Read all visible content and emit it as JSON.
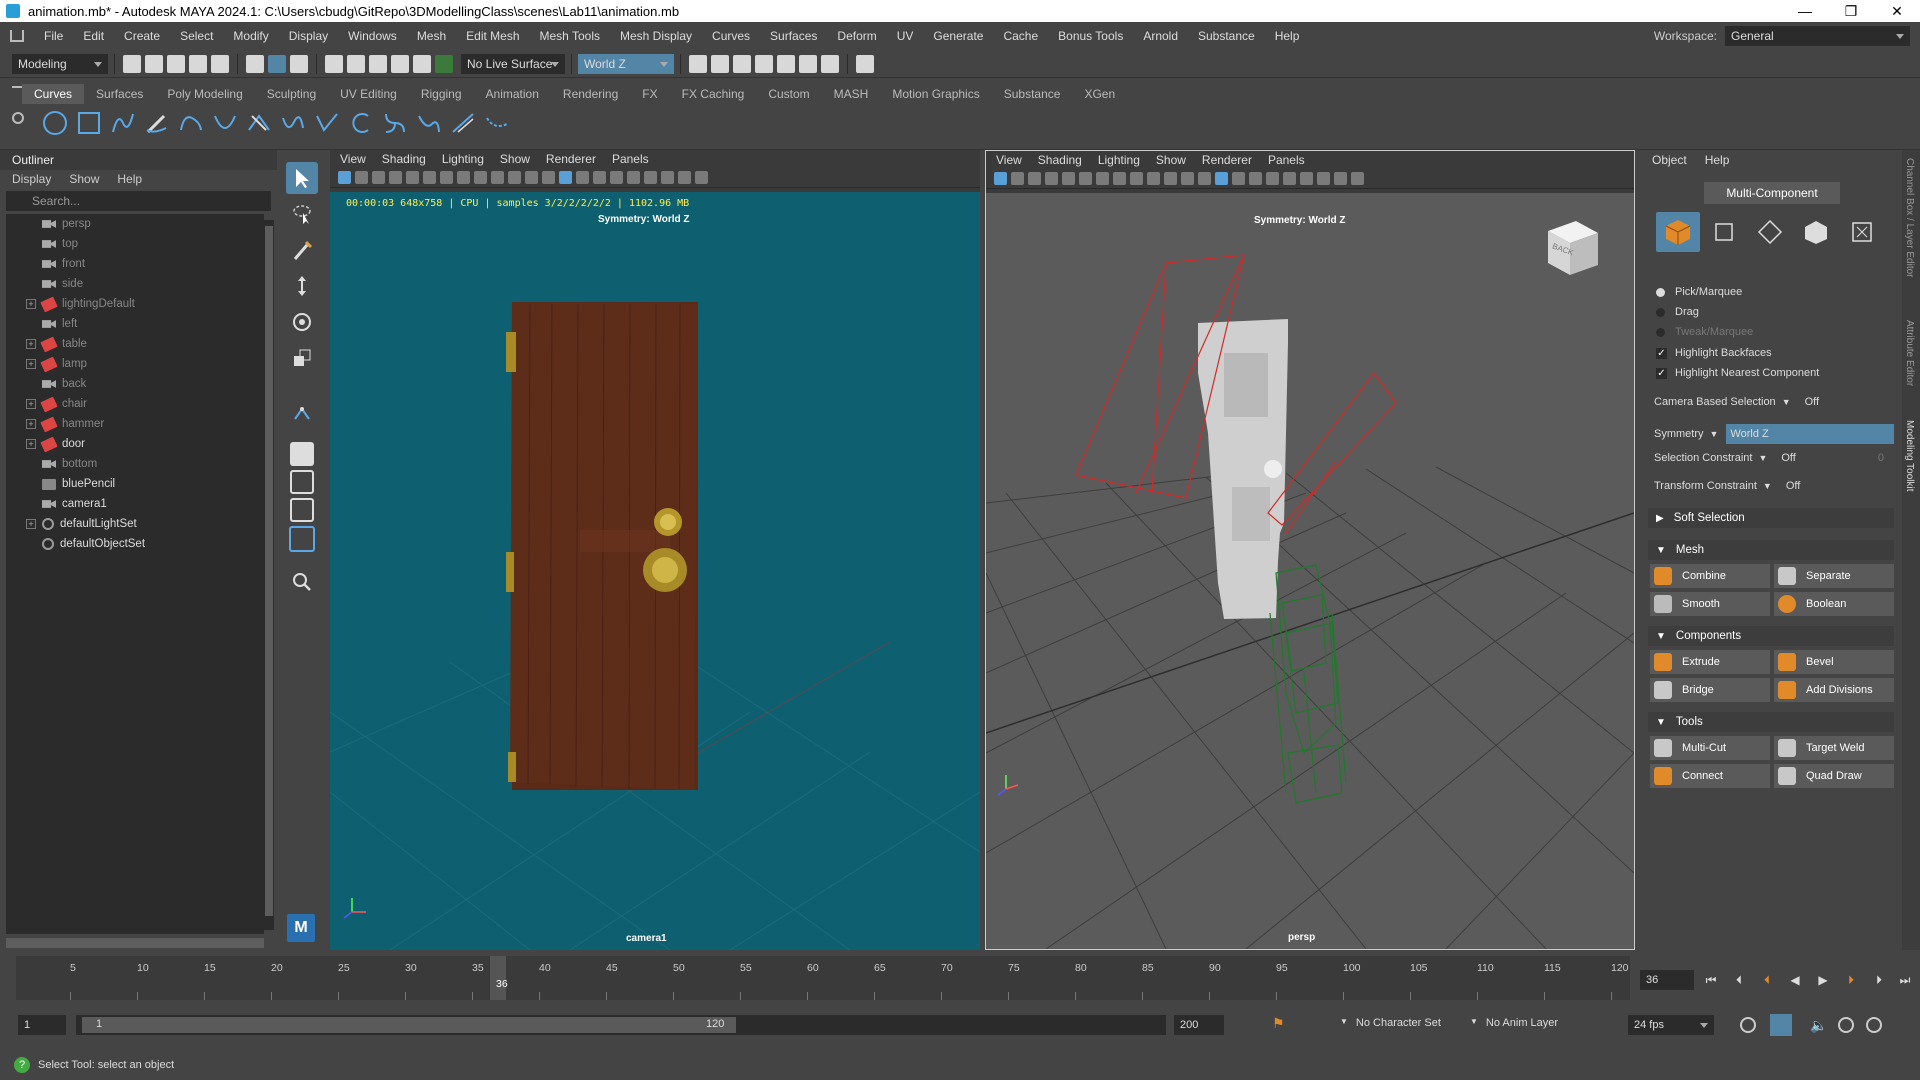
{
  "window": {
    "title": "animation.mb* - Autodesk MAYA 2024.1: C:\\Users\\cbudg\\GitRepo\\3DModellingClass\\scenes\\Lab11\\animation.mb",
    "controls": [
      "—",
      "❐",
      "✕"
    ]
  },
  "menubar": {
    "items": [
      "File",
      "Edit",
      "Create",
      "Select",
      "Modify",
      "Display",
      "Windows",
      "Mesh",
      "Edit Mesh",
      "Mesh Tools",
      "Mesh Display",
      "Curves",
      "Surfaces",
      "Deform",
      "UV",
      "Generate",
      "Cache",
      "Bonus Tools",
      "Arnold",
      "Substance",
      "Help"
    ],
    "workspace_label": "Workspace:",
    "workspace_value": "General"
  },
  "statusline": {
    "mode": "Modeling",
    "live_surface": "No Live Surface",
    "symmetry": "World Z"
  },
  "shelf": {
    "tabs": [
      "Curves",
      "Surfaces",
      "Poly Modeling",
      "Sculpting",
      "UV Editing",
      "Rigging",
      "Animation",
      "Rendering",
      "FX",
      "FX Caching",
      "Custom",
      "MASH",
      "Motion Graphics",
      "Substance",
      "XGen"
    ],
    "active_tab": "Curves",
    "icons": [
      "circle-icon",
      "square-icon",
      "cv-curve-icon",
      "pencil-curve-icon",
      "ep-curve-icon",
      "bezier-icon",
      "arc-icon",
      "curve-edit-icon",
      "sketch-icon",
      "spiral-icon",
      "arc-tool-icon",
      "attach-curve-icon",
      "rebuild-curve-icon",
      "offset-icon",
      "extend-icon"
    ]
  },
  "outliner": {
    "title": "Outliner",
    "menu": [
      "Display",
      "Show",
      "Help"
    ],
    "search_placeholder": "Search...",
    "items": [
      {
        "label": "persp",
        "type": "camera",
        "expandable": false,
        "dim": true
      },
      {
        "label": "top",
        "type": "camera",
        "expandable": false,
        "dim": true
      },
      {
        "label": "front",
        "type": "camera",
        "expandable": false,
        "dim": true
      },
      {
        "label": "side",
        "type": "camera",
        "expandable": false,
        "dim": true
      },
      {
        "label": "lightingDefault",
        "type": "mesh",
        "expandable": true,
        "dim": true
      },
      {
        "label": "left",
        "type": "camera",
        "expandable": false,
        "dim": true
      },
      {
        "label": "table",
        "type": "mesh",
        "expandable": true,
        "dim": true
      },
      {
        "label": "lamp",
        "type": "mesh",
        "expandable": true,
        "dim": true
      },
      {
        "label": "back",
        "type": "camera",
        "expandable": false,
        "dim": true
      },
      {
        "label": "chair",
        "type": "mesh",
        "expandable": true,
        "dim": true
      },
      {
        "label": "hammer",
        "type": "mesh",
        "expandable": true,
        "dim": true
      },
      {
        "label": "door",
        "type": "mesh",
        "expandable": true,
        "dim": false
      },
      {
        "label": "bottom",
        "type": "camera",
        "expandable": false,
        "dim": true
      },
      {
        "label": "bluePencil",
        "type": "pencil",
        "expandable": false,
        "dim": false
      },
      {
        "label": "camera1",
        "type": "camera",
        "expandable": false,
        "dim": false
      },
      {
        "label": "defaultLightSet",
        "type": "set",
        "expandable": true,
        "dim": false
      },
      {
        "label": "defaultObjectSet",
        "type": "set",
        "expandable": false,
        "dim": false
      }
    ]
  },
  "viewport_left": {
    "menu": [
      "View",
      "Shading",
      "Lighting",
      "Show",
      "Renderer",
      "Panels"
    ],
    "stats": "00:00:03 648x758 | CPU | samples 3/2/2/2/2/2 | 1102.96 MB",
    "symmetry": "Symmetry: World Z",
    "camera": "camera1"
  },
  "viewport_right": {
    "menu": [
      "View",
      "Shading",
      "Lighting",
      "Show",
      "Renderer",
      "Panels"
    ],
    "symmetry": "Symmetry: World Z",
    "camera": "persp",
    "viewcube_label": "BACK"
  },
  "modeling_toolkit": {
    "menu": [
      "Object",
      "Help"
    ],
    "mode_button": "Multi-Component",
    "pick_options": [
      "Pick/Marquee",
      "Drag",
      "Tweak/Marquee"
    ],
    "checks": [
      "Highlight Backfaces",
      "Highlight Nearest Component"
    ],
    "camera_based_selection": {
      "label": "Camera Based Selection",
      "value": "Off"
    },
    "symmetry": {
      "label": "Symmetry",
      "value": "World Z"
    },
    "selection_constraint": {
      "label": "Selection Constraint",
      "value": "Off",
      "num": "0"
    },
    "transform_constraint": {
      "label": "Transform Constraint",
      "value": "Off"
    },
    "soft_selection": "Soft Selection",
    "mesh_section": "Mesh",
    "mesh_buttons": [
      "Combine",
      "Separate",
      "Smooth",
      "Boolean"
    ],
    "components_section": "Components",
    "components_buttons": [
      "Extrude",
      "Bevel",
      "Bridge",
      "Add Divisions"
    ],
    "tools_section": "Tools",
    "tools_buttons": [
      "Multi-Cut",
      "Target Weld",
      "Connect",
      "Quad Draw"
    ]
  },
  "side_tabs": [
    "Channel Box / Layer Editor",
    "Attribute Editor",
    "Modeling Toolkit"
  ],
  "timeline": {
    "ticks": [
      "5",
      "10",
      "15",
      "20",
      "25",
      "30",
      "35",
      "40",
      "45",
      "50",
      "55",
      "60",
      "65",
      "70",
      "75",
      "80",
      "85",
      "90",
      "95",
      "100",
      "105",
      "110",
      "115",
      "120"
    ],
    "current_frame": "36",
    "frame_field": "36"
  },
  "range": {
    "start": "1",
    "inner_start": "1",
    "inner_end": "120",
    "end": "200",
    "character_set": "No Character Set",
    "anim_layer": "No Anim Layer",
    "fps": "24 fps"
  },
  "helpline": {
    "text": "Select Tool: select an object"
  }
}
